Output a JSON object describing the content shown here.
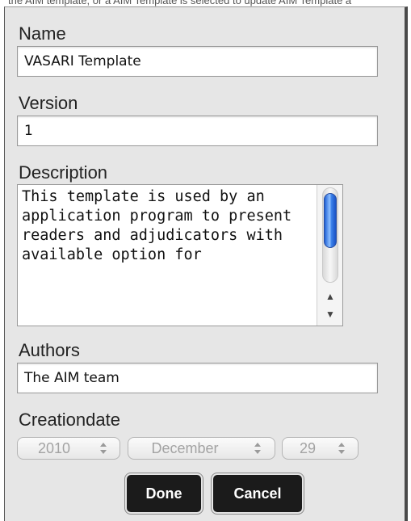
{
  "top_text": "the AIM template, or a AIM Template is selected to update AIM Template a",
  "form": {
    "name": {
      "label": "Name",
      "value": "VASARI Template"
    },
    "version": {
      "label": "Version",
      "value": "1"
    },
    "description": {
      "label": "Description",
      "value": "This template is used by an application program to present readers and adjudicators with available option for"
    },
    "authors": {
      "label": "Authors",
      "value": "The AIM team"
    },
    "creationdate": {
      "label": "Creationdate",
      "year": "2010",
      "month": "December",
      "day": "29"
    }
  },
  "buttons": {
    "done": "Done",
    "cancel": "Cancel"
  },
  "icons": {
    "scroll_up": "scroll-up-arrow-icon",
    "scroll_down": "scroll-down-arrow-icon",
    "stepper": "up-down-stepper-icon"
  },
  "colors": {
    "panel_bg": "#e6e6e6",
    "button_bg": "#1b1b1b",
    "scroll_thumb": "#3b80ea",
    "disabled_text": "#a3a3a3"
  }
}
